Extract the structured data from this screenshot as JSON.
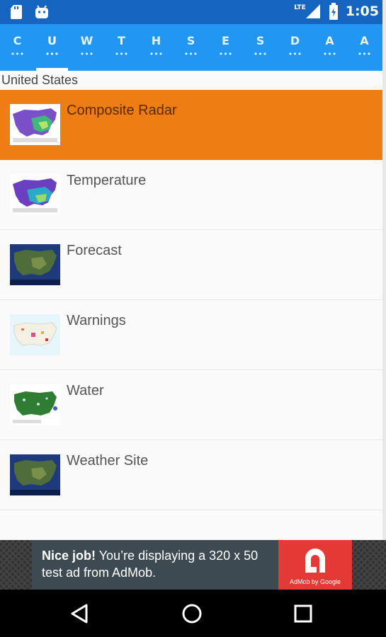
{
  "status_bar": {
    "left_icons": [
      "sd-card-icon",
      "android-icon"
    ],
    "network": "LTE",
    "time": "1:05"
  },
  "tabs": [
    {
      "letter": "C",
      "dots": "•••"
    },
    {
      "letter": "U",
      "dots": "•••",
      "active": true
    },
    {
      "letter": "W",
      "dots": "•••"
    },
    {
      "letter": "T",
      "dots": "•••"
    },
    {
      "letter": "H",
      "dots": "•••"
    },
    {
      "letter": "S",
      "dots": "•••"
    },
    {
      "letter": "E",
      "dots": "•••"
    },
    {
      "letter": "S",
      "dots": "•••"
    },
    {
      "letter": "D",
      "dots": "•••"
    },
    {
      "letter": "A",
      "dots": "•••"
    },
    {
      "letter": "A",
      "dots": "•••"
    }
  ],
  "section_title": "United States",
  "items": [
    {
      "label": "Composite Radar",
      "thumb": "composite-radar-map-thumbnail",
      "selected": true
    },
    {
      "label": "Temperature",
      "thumb": "temperature-map-thumbnail"
    },
    {
      "label": "Forecast",
      "thumb": "forecast-map-thumbnail"
    },
    {
      "label": "Warnings",
      "thumb": "warnings-map-thumbnail"
    },
    {
      "label": "Water",
      "thumb": "water-map-thumbnail"
    },
    {
      "label": "Weather Site",
      "thumb": "weather-site-map-thumbnail"
    }
  ],
  "ad": {
    "bold": "Nice job!",
    "text": " You’re displaying a 320 x 50 test ad from AdMob.",
    "logo_caption": "AdMob by Google"
  },
  "colors": {
    "status_bar": "#1565c0",
    "tab_bar": "#2196f3",
    "selected_row": "#ee7d14",
    "ad_logo": "#e53935"
  }
}
